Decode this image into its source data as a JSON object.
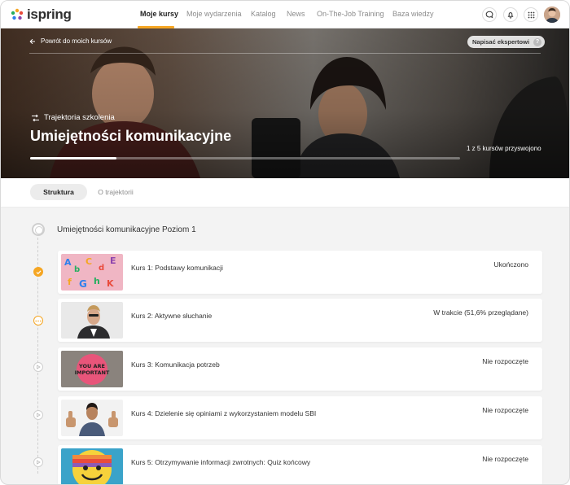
{
  "brand": {
    "name": "ispring"
  },
  "nav": {
    "items": [
      {
        "label": "Moje kursy",
        "active": true
      },
      {
        "label": "Moje wydarzenia",
        "active": false
      },
      {
        "label": "Katalog",
        "active": false
      },
      {
        "label": "News",
        "active": false
      },
      {
        "label": "On-The-Job Training",
        "active": false
      },
      {
        "label": "Baza wiedzy",
        "active": false
      }
    ],
    "icons": [
      "chat-icon",
      "bell-icon",
      "apps-grid-icon"
    ]
  },
  "hero": {
    "back_label": "Powrót do moich kursów",
    "ask_expert_label": "Napisać ekspertowi",
    "ask_expert_icon": "?",
    "path_label": "Trajektoria szkolenia",
    "title": "Umiejętności komunikacyjne",
    "progress_text": "1 z 5 kursów przyswojono",
    "progress_fraction": 0.2
  },
  "tabs": [
    {
      "label": "Struktura",
      "active": true
    },
    {
      "label": "O trajektorii",
      "active": false
    }
  ],
  "module": {
    "title": "Umiejętności komunikacyjne Poziom 1",
    "courses": [
      {
        "name": "Kurs 1: Podstawy komunikacji",
        "status": "Ukończono",
        "state": "done",
        "thumb": "letters"
      },
      {
        "name": "Kurs 2: Aktywne słuchanie",
        "status": "W trakcie (51,6% przeglądane)",
        "state": "in-progress",
        "thumb": "man-listening"
      },
      {
        "name": "Kurs 3: Komunikacja potrzeb",
        "status": "Nie rozpoczęte",
        "state": "not-started",
        "thumb": "you-are-important",
        "thumb_text_1": "YOU ARE",
        "thumb_text_2": "IMPORTANT"
      },
      {
        "name": "Kurs 4: Dzielenie się opiniami z wykorzystaniem modelu SBI",
        "status": "Nie rozpoczęte",
        "state": "not-started",
        "thumb": "thumbs-up"
      },
      {
        "name": "Kurs 5: Otrzymywanie informacji zwrotnych: Quiz końcowy",
        "status": "Nie rozpoczęte",
        "state": "not-started",
        "thumb": "smiley"
      }
    ]
  },
  "colors": {
    "accent": "#f5a623",
    "text": "#333333",
    "muted": "#8c8c8c"
  }
}
